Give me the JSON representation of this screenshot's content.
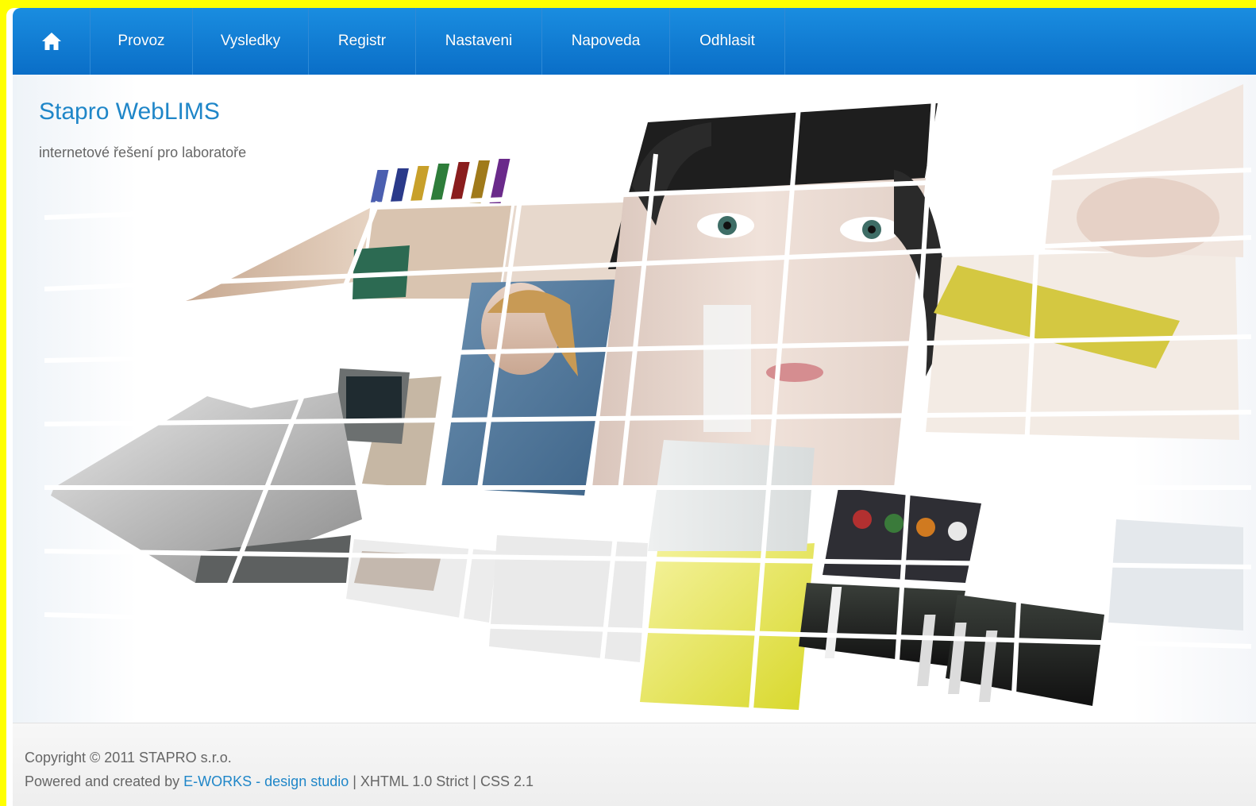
{
  "nav": {
    "home_icon": "home-icon",
    "items": [
      {
        "label": "Provoz"
      },
      {
        "label": "Vysledky"
      },
      {
        "label": "Registr"
      },
      {
        "label": "Nastaveni"
      },
      {
        "label": "Napoveda"
      },
      {
        "label": "Odhlasit"
      }
    ]
  },
  "header": {
    "title": "Stapro WebLIMS",
    "subtitle": "internetové řešení pro laboratoře"
  },
  "hero": {
    "image": "laboratory-collage-image"
  },
  "footer": {
    "copyright": "Copyright © 2011 STAPRO s.r.o.",
    "powered_prefix": "Powered and created by ",
    "eworks_link": "E-WORKS",
    "dash": " - ",
    "studio_link": "design studio",
    "sep1": " | ",
    "xhtml_link": "XHTML 1.0 Strict",
    "sep2": " | ",
    "css_link": "CSS 2.1"
  },
  "colors": {
    "nav_background": "#0a6ec7",
    "title": "#1f86c8",
    "page_border": "#ffff00"
  }
}
